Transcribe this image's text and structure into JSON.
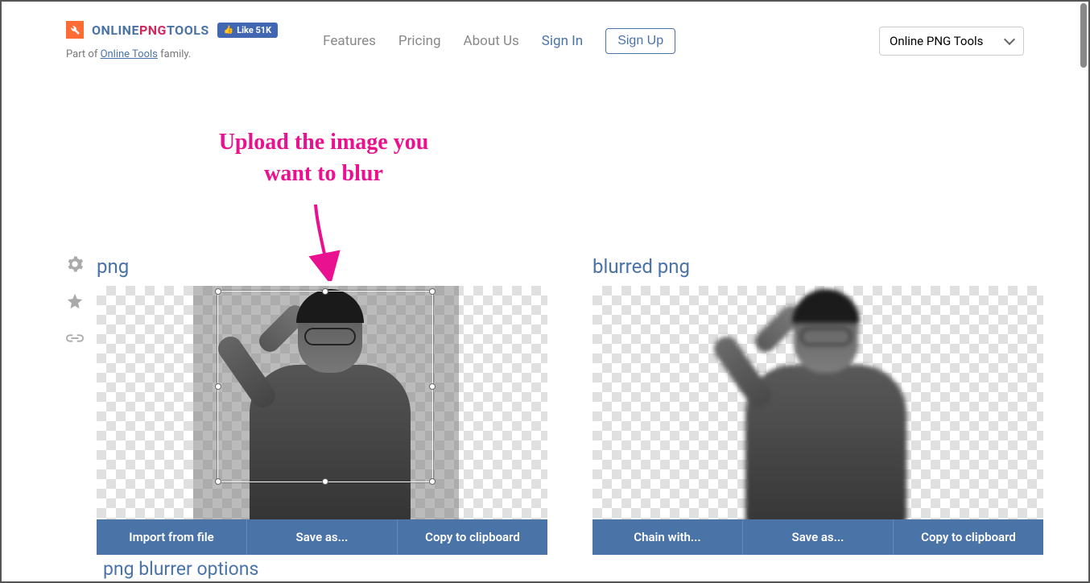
{
  "header": {
    "logo": {
      "online": "ONLINE",
      "png": "PNG",
      "tools": "TOOLS"
    },
    "fb_like": "Like 51K",
    "part_of_prefix": "Part of ",
    "part_of_link": "Online Tools",
    "part_of_suffix": " family.",
    "nav": {
      "features": "Features",
      "pricing": "Pricing",
      "about": "About Us",
      "signin": "Sign In",
      "signup": "Sign Up"
    },
    "site_select": "Online PNG Tools"
  },
  "annotation": {
    "line1": "Upload the image you",
    "line2": "want to blur"
  },
  "panels": {
    "input": {
      "title": "png",
      "buttons": {
        "import": "Import from file",
        "save": "Save as...",
        "copy": "Copy to clipboard"
      }
    },
    "output": {
      "title": "blurred png",
      "buttons": {
        "chain": "Chain with...",
        "save": "Save as...",
        "copy": "Copy to clipboard"
      }
    }
  },
  "options_title": "png blurrer options"
}
